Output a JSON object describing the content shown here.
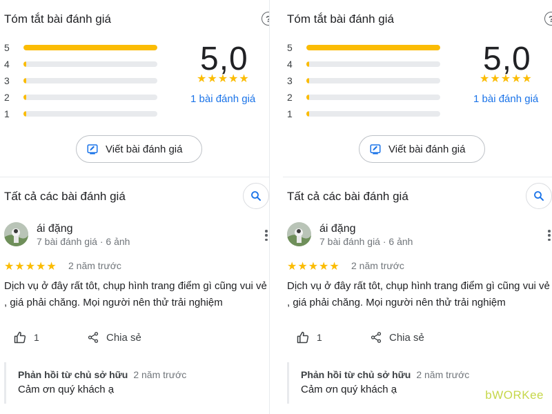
{
  "summary": {
    "title": "Tóm tắt bài đánh giá",
    "help_icon": "question-circle-icon",
    "distribution": [
      {
        "label": "5",
        "fraction": 1.0
      },
      {
        "label": "4",
        "fraction": 0.0
      },
      {
        "label": "3",
        "fraction": 0.0
      },
      {
        "label": "2",
        "fraction": 0.0
      },
      {
        "label": "1",
        "fraction": 0.0
      }
    ],
    "average": "5,0",
    "stars": "★★★★★",
    "count_link": "1 bài đánh giá",
    "write_button": "Viết bài đánh giá"
  },
  "reviews_section": {
    "title": "Tất cả các bài đánh giá",
    "search_icon": "search-icon"
  },
  "review": {
    "author": "ái đặng",
    "meta": "7 bài đánh giá · 6 ảnh",
    "stars": "★★★★★",
    "rating": 5,
    "time": "2 năm trước",
    "text": "Dịch vụ ở đây rất tôt, chụp hình trang điểm gì cũng vui vẻ , giá phải chăng. Mọi người nên thử trải nghiệm",
    "likes": "1",
    "share_label": "Chia sẻ",
    "owner_reply": {
      "author": "Phản hồi từ chủ sở hữu",
      "time": "2 năm trước",
      "text": "Cảm ơn quý khách ạ"
    }
  },
  "colors": {
    "star": "#fbbc04",
    "link": "#1a73e8",
    "watermark": "#c6d74a"
  },
  "watermark": "bWORKee"
}
